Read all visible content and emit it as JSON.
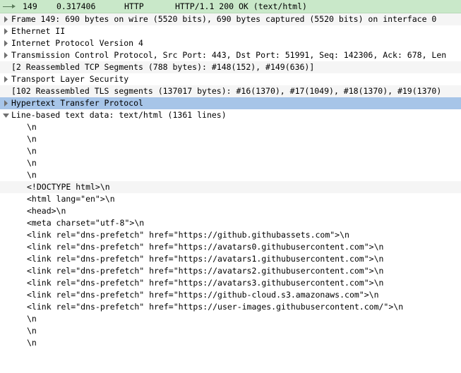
{
  "header": {
    "frame": "149",
    "time": "0.317406",
    "protocol": "HTTP",
    "info": "HTTP/1.1 200 OK  (text/html)"
  },
  "tree": [
    {
      "indent": 0,
      "twisty": "closed",
      "bg": "dim",
      "text": "Frame 149: 690 bytes on wire (5520 bits), 690 bytes captured (5520 bits) on interface 0"
    },
    {
      "indent": 0,
      "twisty": "closed",
      "bg": "plain",
      "text": "Ethernet II"
    },
    {
      "indent": 0,
      "twisty": "closed",
      "bg": "plain",
      "text": "Internet Protocol Version 4"
    },
    {
      "indent": 0,
      "twisty": "closed",
      "bg": "plain",
      "text": "Transmission Control Protocol, Src Port: 443, Dst Port: 51991, Seq: 142306, Ack: 678, Len"
    },
    {
      "indent": 0,
      "twisty": "none",
      "bg": "dim",
      "text": "[2 Reassembled TCP Segments (788 bytes): #148(152), #149(636)]"
    },
    {
      "indent": 0,
      "twisty": "closed",
      "bg": "plain",
      "text": "Transport Layer Security"
    },
    {
      "indent": 0,
      "twisty": "none",
      "bg": "dim",
      "text": "[102 Reassembled TLS segments (137017 bytes): #16(1370), #17(1049), #18(1370), #19(1370)"
    },
    {
      "indent": 0,
      "twisty": "closed",
      "bg": "sel",
      "text": "Hypertext Transfer Protocol"
    },
    {
      "indent": 0,
      "twisty": "open",
      "bg": "plain",
      "text": "Line-based text data: text/html (1361 lines)"
    },
    {
      "indent": 2,
      "twisty": "none",
      "bg": "plain",
      "text": "\\n"
    },
    {
      "indent": 2,
      "twisty": "none",
      "bg": "plain",
      "text": "\\n"
    },
    {
      "indent": 2,
      "twisty": "none",
      "bg": "plain",
      "text": "\\n"
    },
    {
      "indent": 2,
      "twisty": "none",
      "bg": "plain",
      "text": "\\n"
    },
    {
      "indent": 2,
      "twisty": "none",
      "bg": "plain",
      "text": "\\n"
    },
    {
      "indent": 2,
      "twisty": "none",
      "bg": "dim",
      "text": "<!DOCTYPE html>\\n"
    },
    {
      "indent": 2,
      "twisty": "none",
      "bg": "plain",
      "text": "<html lang=\"en\">\\n"
    },
    {
      "indent": 2,
      "twisty": "none",
      "bg": "plain",
      "text": "  <head>\\n"
    },
    {
      "indent": 2,
      "twisty": "none",
      "bg": "plain",
      "text": "    <meta charset=\"utf-8\">\\n"
    },
    {
      "indent": 2,
      "twisty": "none",
      "bg": "plain",
      "text": "  <link rel=\"dns-prefetch\" href=\"https://github.githubassets.com\">\\n"
    },
    {
      "indent": 2,
      "twisty": "none",
      "bg": "plain",
      "text": "  <link rel=\"dns-prefetch\" href=\"https://avatars0.githubusercontent.com\">\\n"
    },
    {
      "indent": 2,
      "twisty": "none",
      "bg": "plain",
      "text": "  <link rel=\"dns-prefetch\" href=\"https://avatars1.githubusercontent.com\">\\n"
    },
    {
      "indent": 2,
      "twisty": "none",
      "bg": "plain",
      "text": "  <link rel=\"dns-prefetch\" href=\"https://avatars2.githubusercontent.com\">\\n"
    },
    {
      "indent": 2,
      "twisty": "none",
      "bg": "plain",
      "text": "  <link rel=\"dns-prefetch\" href=\"https://avatars3.githubusercontent.com\">\\n"
    },
    {
      "indent": 2,
      "twisty": "none",
      "bg": "plain",
      "text": "  <link rel=\"dns-prefetch\" href=\"https://github-cloud.s3.amazonaws.com\">\\n"
    },
    {
      "indent": 2,
      "twisty": "none",
      "bg": "plain",
      "text": "  <link rel=\"dns-prefetch\" href=\"https://user-images.githubusercontent.com/\">\\n"
    },
    {
      "indent": 2,
      "twisty": "none",
      "bg": "plain",
      "text": "\\n"
    },
    {
      "indent": 2,
      "twisty": "none",
      "bg": "plain",
      "text": "\\n"
    },
    {
      "indent": 2,
      "twisty": "none",
      "bg": "plain",
      "text": "\\n"
    }
  ]
}
